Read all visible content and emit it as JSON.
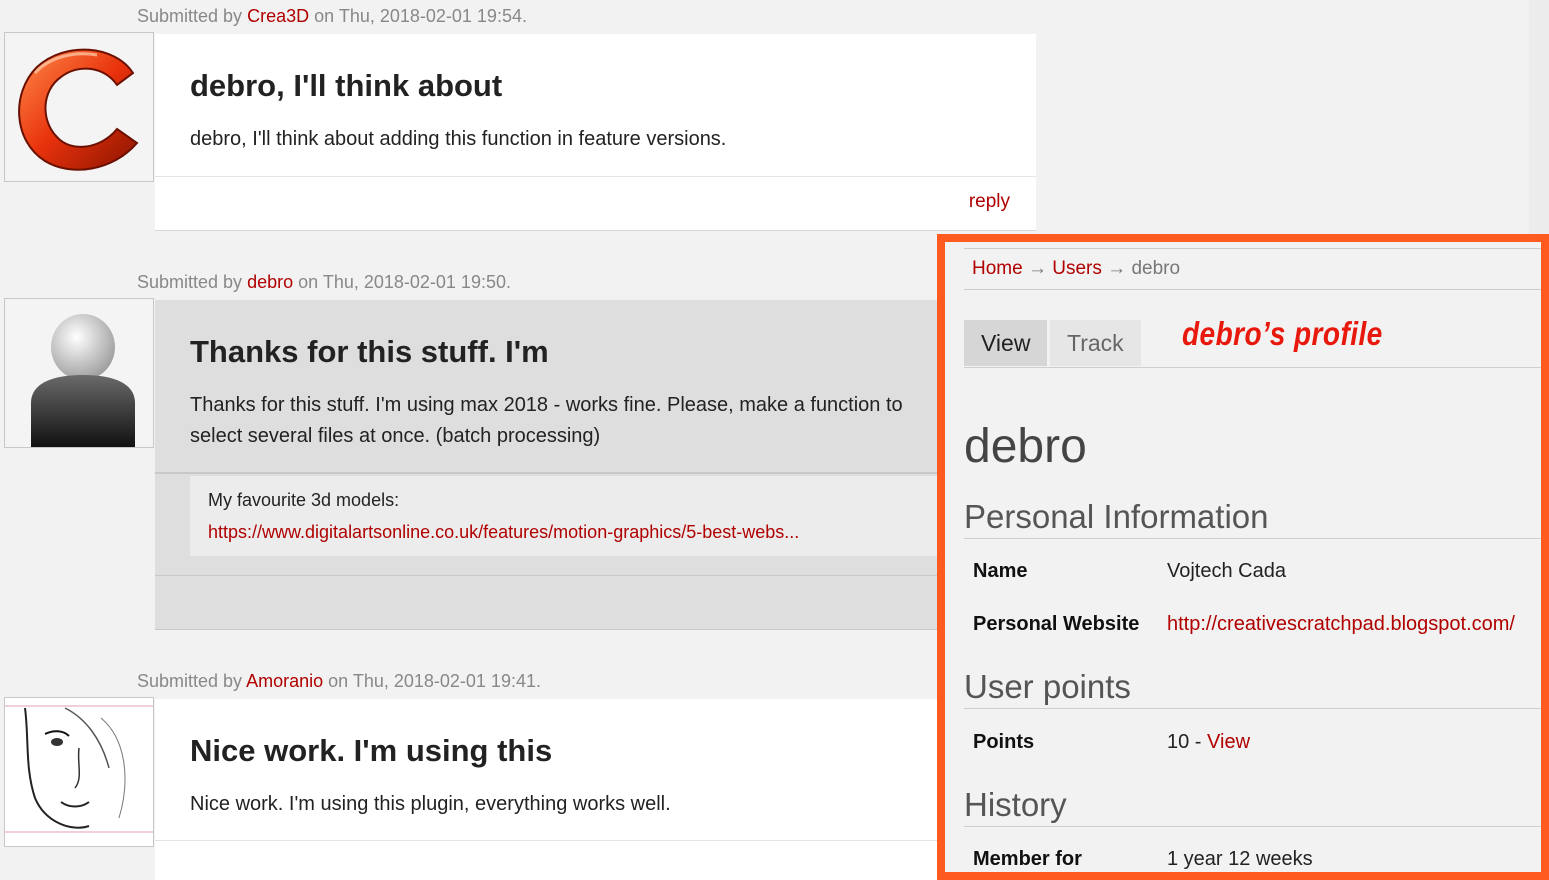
{
  "comments": [
    {
      "submitted_prefix": "Submitted by",
      "author": "Crea3D",
      "date_text": "on Thu, 2018-02-01 19:54.",
      "title": "debro, I'll think about",
      "body": "debro, I'll think about adding this function in feature versions.",
      "reply_label": "reply"
    },
    {
      "submitted_prefix": "Submitted by",
      "author": "debro",
      "date_text": "on Thu, 2018-02-01 19:50.",
      "title": "Thanks for this stuff. I'm",
      "body_line1": "Thanks for this stuff. I'm using max 2018 - works fine. Please, make a function to",
      "body_line2": "select several files at once. (batch processing)",
      "signature_label": "My favourite 3d models:",
      "signature_link": "https://www.digitalartsonline.co.uk/features/motion-graphics/5-best-webs..."
    },
    {
      "submitted_prefix": "Submitted by",
      "author": "Amoranio",
      "date_text": "on Thu, 2018-02-01 19:41.",
      "title": "Nice work. I'm using this",
      "body": "Nice work. I'm using this plugin, everything works well."
    }
  ],
  "profile": {
    "breadcrumb": {
      "home": "Home",
      "sep": "→",
      "users": "Users",
      "current": "debro"
    },
    "tabs": {
      "view": "View",
      "track": "Track"
    },
    "note": "debro’s profile",
    "username": "debro",
    "personal_info_heading": "Personal Information",
    "name_label": "Name",
    "name_value": "Vojtech Cada",
    "website_label": "Personal Website",
    "website_value": "http://creativescratchpad.blogspot.com/",
    "user_points_heading": "User points",
    "points_label": "Points",
    "points_value": "10 -",
    "points_link": "View",
    "history_heading": "History",
    "member_label": "Member for",
    "member_value": "1 year 12 weeks"
  },
  "colors": {
    "accent_border": "#ff5a1f",
    "link": "#b00000",
    "note": "#e8180c"
  }
}
